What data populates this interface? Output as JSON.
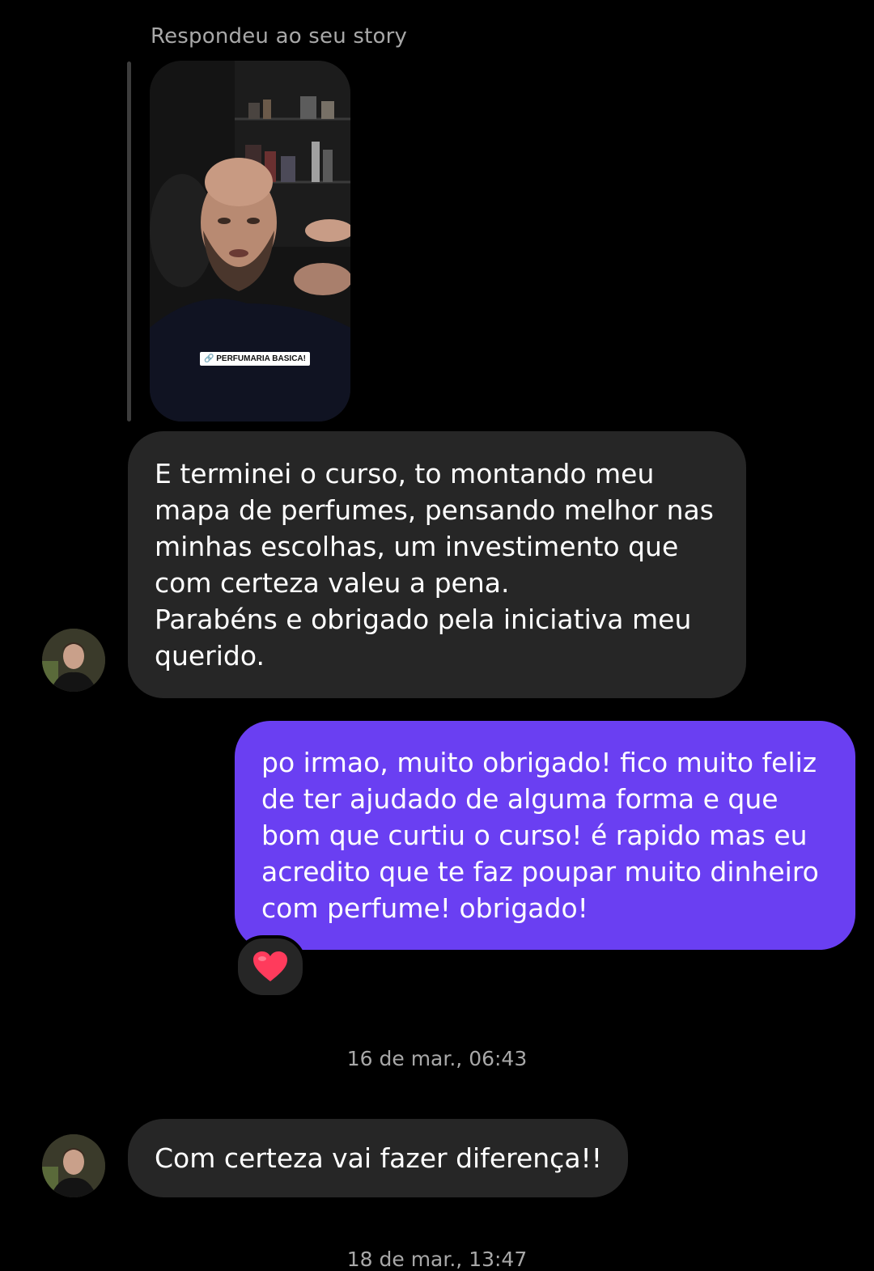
{
  "story_reply": {
    "caption": "Respondeu ao seu story",
    "sticker_text": "🔗 PERFUMARIA BASICA!"
  },
  "messages": [
    {
      "direction": "incoming",
      "text": "E terminei o curso, to montando meu\nmapa de perfumes, pensando melhor nas\nminhas escolhas, um investimento que\ncom certeza valeu a pena.\nParabéns e obrigado pela iniciativa meu\nquerido."
    },
    {
      "direction": "outgoing",
      "text": "po irmao, muito obrigado! fico muito feliz\nde ter ajudado de alguma forma e que\nbom que curtiu o curso! é rapido mas eu\nacredito que te faz poupar muito dinheiro\ncom perfume! obrigado!",
      "reaction": "heart-icon"
    },
    {
      "direction": "incoming",
      "text": "Com certeza vai fazer diferença!!"
    }
  ],
  "timestamps": [
    "16 de mar., 06:43",
    "18 de mar., 13:47"
  ],
  "colors": {
    "background": "#000000",
    "incoming_bubble": "#262626",
    "outgoing_bubble": "#6a3ff2",
    "secondary_text": "#a8a8a8",
    "reaction_heart": "#ff3b5c"
  }
}
